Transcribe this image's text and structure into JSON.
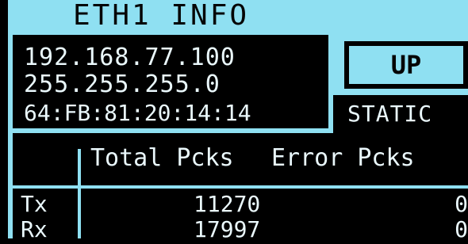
{
  "header": {
    "title": "ETH1 INFO"
  },
  "interface": {
    "ip_address": "192.168.77.100",
    "subnet_mask": "255.255.255.0",
    "mac_address": "64:FB:81:20:14:14",
    "link_state": "UP",
    "addressing_mode": "STATIC"
  },
  "stats_table": {
    "columns": [
      "Total Pcks",
      "Error Pcks"
    ],
    "rows": [
      {
        "label": "Tx",
        "total": "11270",
        "error": "0"
      },
      {
        "label": "Rx",
        "total": "17997",
        "error": "0"
      }
    ]
  },
  "colors": {
    "accent": "#8fe0f2",
    "background": "#000000",
    "text": "#eaf8fc"
  }
}
